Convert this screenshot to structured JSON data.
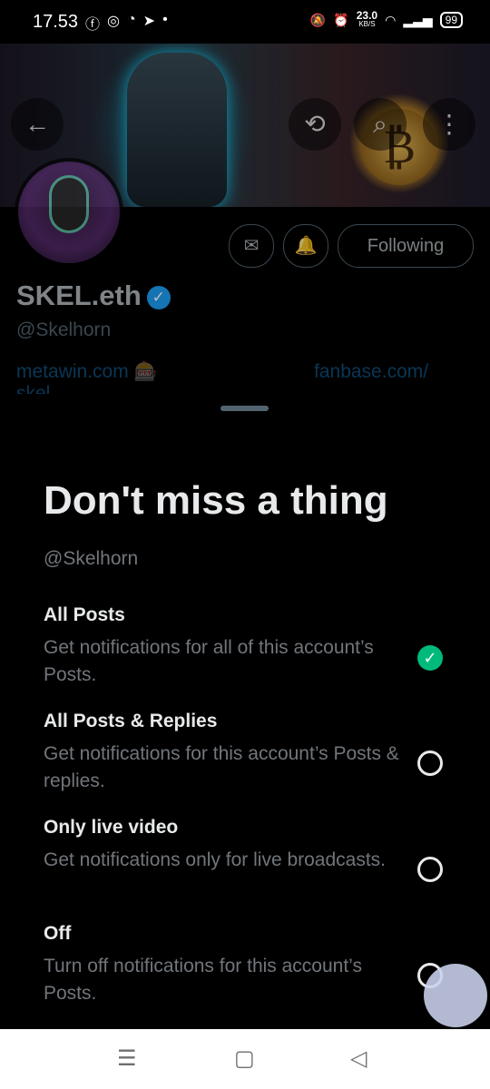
{
  "status": {
    "time": "17.53",
    "app_icons": [
      "facebook-icon",
      "instagram-icon",
      "discord-icon",
      "telegram-icon",
      "dot-icon"
    ],
    "speed_value": "23.0",
    "speed_unit": "KB/S",
    "battery": "99"
  },
  "profile": {
    "name": "SKEL.eth",
    "handle": "@Skelhorn",
    "link1": "metawin.com 🎰",
    "link2": "fanbase.com/",
    "link2_cont": "skel"
  },
  "actions": {
    "following": "Following"
  },
  "sheet": {
    "title": "Don't miss a thing",
    "handle": "@Skelhorn",
    "options": [
      {
        "title": "All Posts",
        "description": "Get notifications for all of this account’s Posts.",
        "selected": true
      },
      {
        "title": "All Posts & Replies",
        "description": "Get notifications for this account’s Posts & replies.",
        "selected": false
      },
      {
        "title": "Only live video",
        "description": "Get notifications only for live broadcasts.",
        "selected": false
      },
      {
        "title": "Off",
        "description": "Turn off notifications for this account’s Posts.",
        "selected": false
      }
    ]
  },
  "colors": {
    "accent": "#1d9bf0",
    "selected": "#00ba7c",
    "background": "#000000"
  },
  "icons": [
    "back-icon",
    "refresh-icon",
    "search-icon",
    "more-icon",
    "mail-icon",
    "bell-icon",
    "verified-icon",
    "check-icon",
    "menu-icon",
    "home-icon",
    "back-nav-icon"
  ]
}
